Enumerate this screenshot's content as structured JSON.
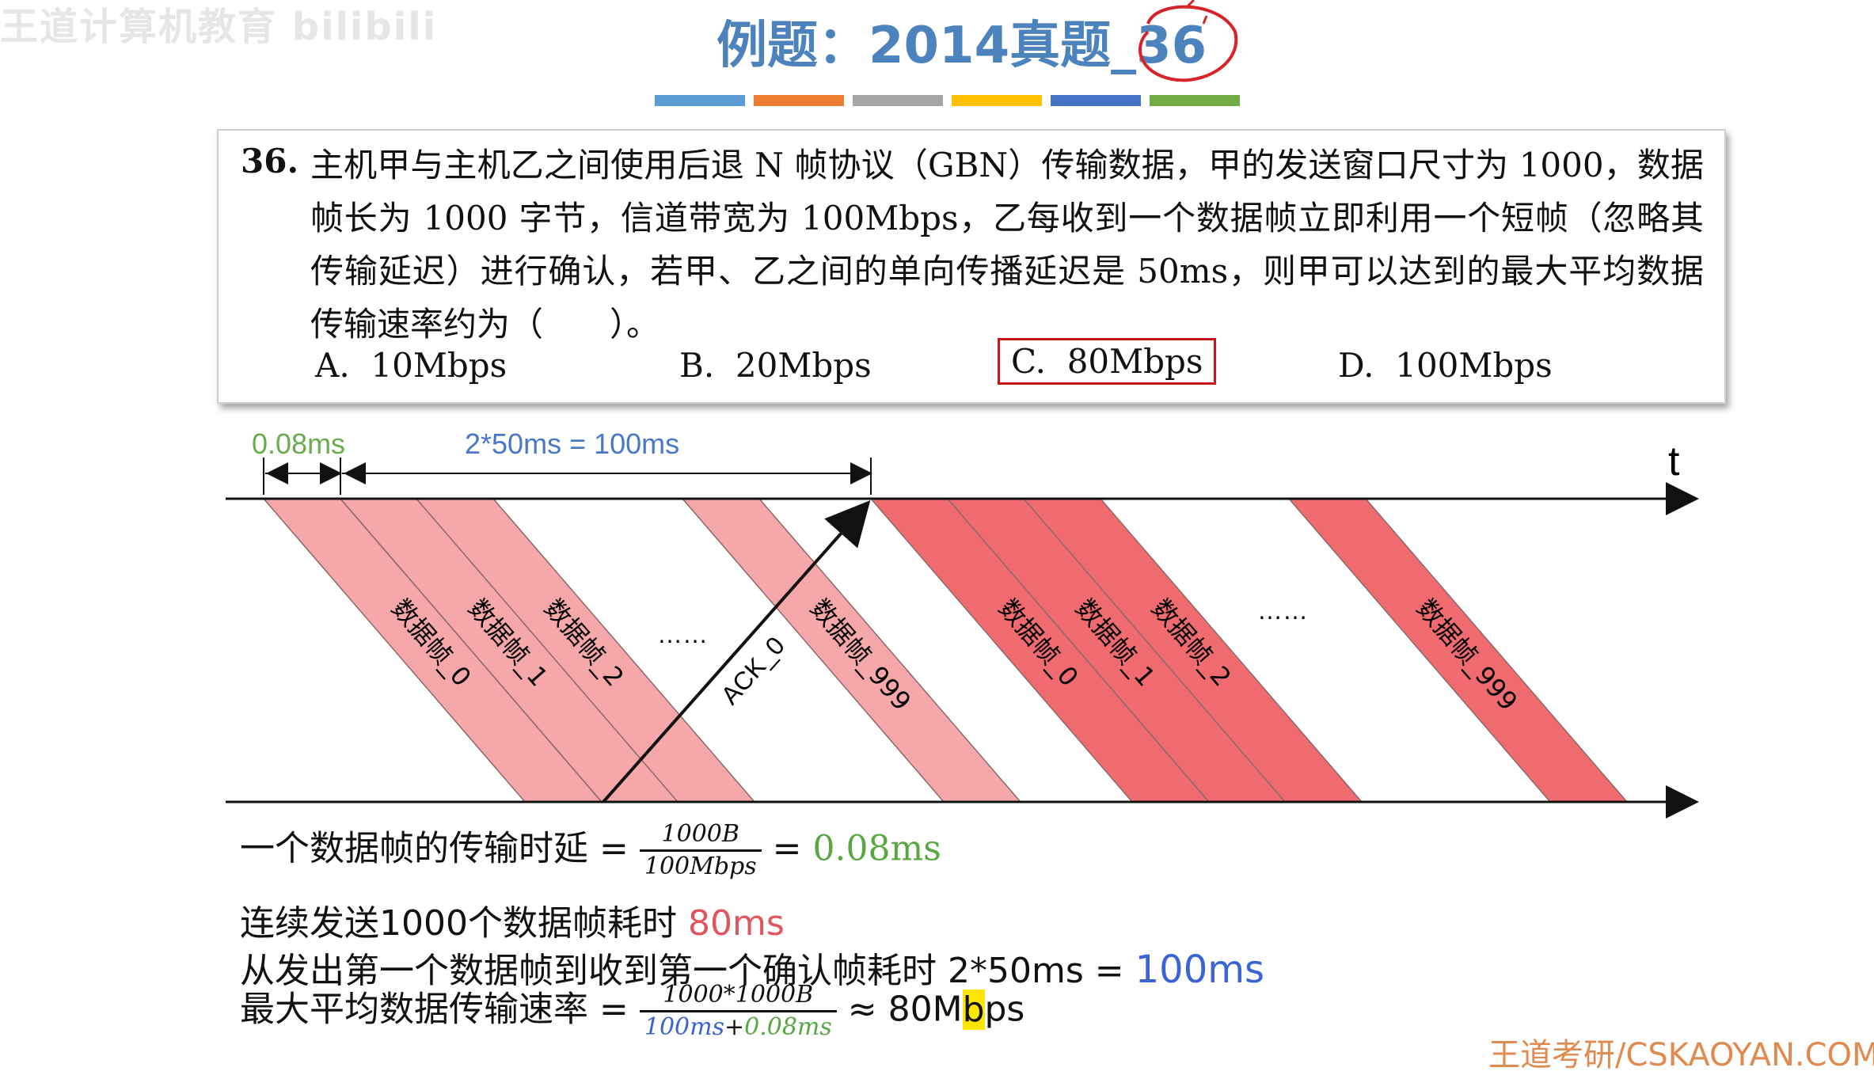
{
  "watermark": "王道计算机教育 bilibili",
  "title": {
    "prefix": "例题：2014真题_",
    "number": "36"
  },
  "colorbars": [
    "#5b9bd5",
    "#ed7d31",
    "#a5a5a5",
    "#ffc000",
    "#4472c4",
    "#70ad47"
  ],
  "question": {
    "number": "36.",
    "text": "主机甲与主机乙之间使用后退 N 帧协议（GBN）传输数据，甲的发送窗口尺寸为 1000，数据帧长为 1000 字节，信道带宽为 100Mbps，乙每收到一个数据帧立即利用一个短帧（忽略其传输延迟）进行确认，若甲、乙之间的单向传播延迟是 50ms，则甲可以达到的最大平均数据传输速率约为（　　）。",
    "options": [
      {
        "label": "A.",
        "value": "10Mbps"
      },
      {
        "label": "B.",
        "value": "20Mbps"
      },
      {
        "label": "C.",
        "value": "80Mbps"
      },
      {
        "label": "D.",
        "value": "100Mbps"
      }
    ]
  },
  "diagram": {
    "axis_label": "t",
    "dim_transmit": "0.08ms",
    "dim_rtt": "2*50ms = 100ms",
    "ellipsis": "……",
    "ack_label": "ACK_0",
    "first_batch": [
      "数据帧_0",
      "数据帧_1",
      "数据帧_2",
      "数据帧_999"
    ],
    "second_batch": [
      "数据帧_0",
      "数据帧_1",
      "数据帧_2",
      "数据帧_999"
    ],
    "colors": {
      "first": "#f5a7aa",
      "second": "#ef6b6f",
      "dim_green": "#6aac4e",
      "dim_blue": "#4a78c9"
    }
  },
  "formulas": {
    "line1_prefix": "一个数据帧的传输时延 =",
    "line1_num": "1000B",
    "line1_den": "100Mbps",
    "line1_eq": "=",
    "line1_result": "0.08ms",
    "line2_prefix": "连续发送1000个数据帧耗时",
    "line2_result": "80ms",
    "line3_prefix": "从发出第一个数据帧到收到第一个确认帧耗时",
    "line3_mid": "2*50ms =",
    "line3_result": "100ms",
    "line4_prefix": "最大平均数据传输速率 =",
    "line4_num": "1000*1000B",
    "line4_den_a": "100ms",
    "line4_den_plus": "+",
    "line4_den_b": "0.08ms",
    "line4_result_a": "≈ 80M",
    "line4_result_b": "b",
    "line4_result_c": "ps"
  },
  "brand": "王道考研/CSKAOYAN.COM"
}
